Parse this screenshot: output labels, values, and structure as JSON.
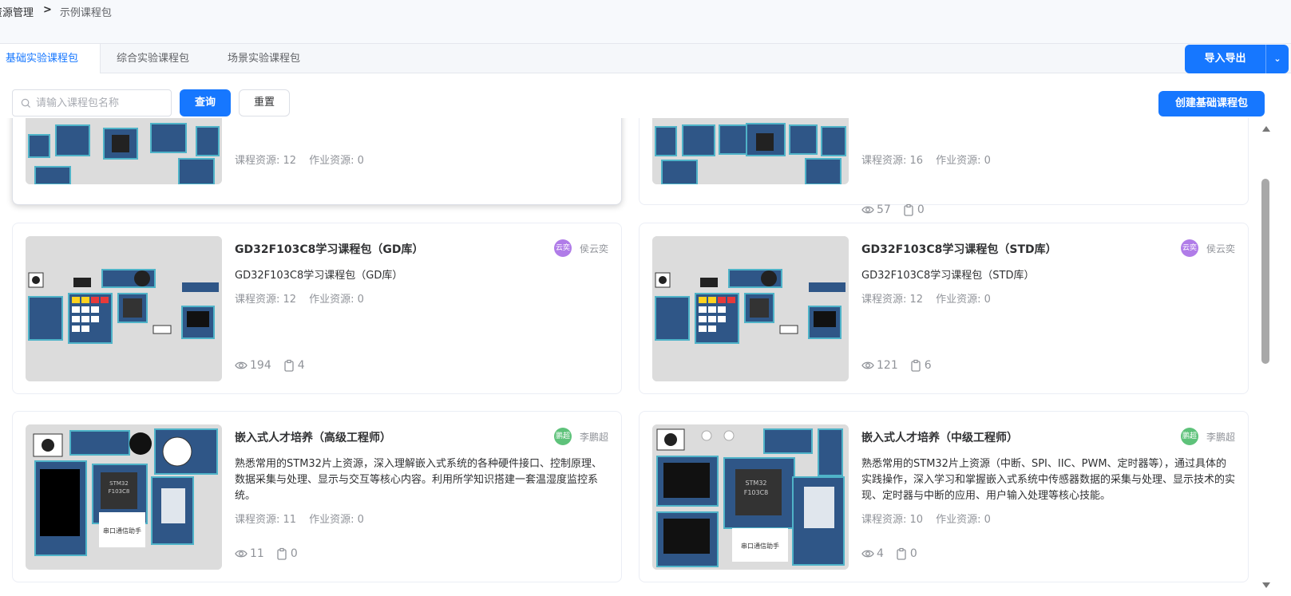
{
  "breadcrumb": {
    "root": "资源管理",
    "current": "示例课程包"
  },
  "tabs": [
    {
      "label": "基础实验课程包",
      "active": true
    },
    {
      "label": "综合实验课程包",
      "active": false
    },
    {
      "label": "场景实验课程包",
      "active": false
    }
  ],
  "actions": {
    "import_export": "导入导出",
    "create": "创建基础课程包"
  },
  "search": {
    "placeholder": "请输入课程包名称",
    "value": "",
    "query": "查询",
    "reset": "重置"
  },
  "cards": [
    {
      "title": "",
      "author": "",
      "desc": "",
      "course_res": "课程资源: 12",
      "homework_res": "作业资源: 0",
      "views": "",
      "likes": ""
    },
    {
      "title": "",
      "author": "",
      "desc": "",
      "course_res": "课程资源: 16",
      "homework_res": "作业资源: 0",
      "views": "57",
      "likes": "0"
    },
    {
      "title": "GD32F103C8学习课程包（GD库）",
      "author": "侯云奕",
      "avatar": "云奕",
      "avatar_color": "#b07ce8",
      "desc": "GD32F103C8学习课程包（GD库）",
      "course_res": "课程资源: 12",
      "homework_res": "作业资源: 0",
      "views": "194",
      "likes": "4"
    },
    {
      "title": "GD32F103C8学习课程包（STD库）",
      "author": "侯云奕",
      "avatar": "云奕",
      "avatar_color": "#b07ce8",
      "desc": "GD32F103C8学习课程包（STD库）",
      "course_res": "课程资源: 12",
      "homework_res": "作业资源: 0",
      "views": "121",
      "likes": "6"
    },
    {
      "title": "嵌入式人才培养（高级工程师）",
      "author": "李鹏超",
      "avatar": "鹏超",
      "avatar_color": "#5ec27a",
      "desc": "熟悉常用的STM32片上资源，深入理解嵌入式系统的各种硬件接口、控制原理、数据采集与处理、显示与交互等核心内容。利用所学知识搭建一套温湿度监控系统。",
      "course_res": "课程资源: 11",
      "homework_res": "作业资源: 0",
      "views": "11",
      "likes": "0"
    },
    {
      "title": "嵌入式人才培养（中级工程师）",
      "author": "李鹏超",
      "avatar": "鹏超",
      "avatar_color": "#5ec27a",
      "desc": "熟悉常用的STM32片上资源（中断、SPI、IIC、PWM、定时器等），通过具体的实践操作，深入学习和掌握嵌入式系统中传感器数据的采集与处理、显示技术的实现、定时器与中断的应用、用户输入处理等核心技能。",
      "course_res": "课程资源: 10",
      "homework_res": "作业资源: 0",
      "views": "4",
      "likes": "0"
    }
  ],
  "thumb_labels": {
    "chip_top": "STM32",
    "chip_bottom": "F103C8",
    "serial": "串口通信助手"
  },
  "colors": {
    "primary": "#1677ff",
    "board": "#2f5687",
    "board_edge": "#4fb3c8"
  }
}
